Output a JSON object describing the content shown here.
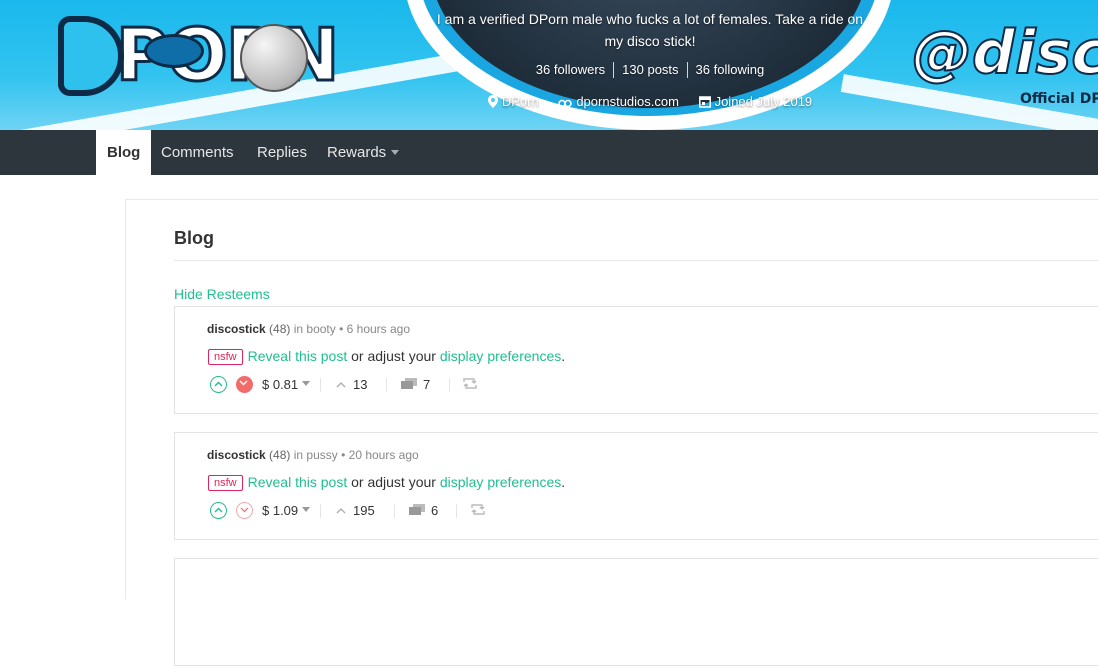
{
  "banner": {
    "logo_text": "DPORN",
    "about": "I am a verified DPorn male who fucks a lot of females. Take a ride on my disco stick!",
    "followers": "36 followers",
    "posts": "130 posts",
    "following": "36 following",
    "location": "DPorn",
    "website": "dpornstudios.com",
    "joined": "Joined July 2019",
    "handle": "@disco",
    "handle_sub": "Official DP"
  },
  "nav": {
    "tabs": [
      {
        "label": "Blog"
      },
      {
        "label": "Comments"
      },
      {
        "label": "Replies"
      },
      {
        "label": "Rewards"
      }
    ]
  },
  "main": {
    "title": "Blog",
    "hide_resteems": "Hide Resteems"
  },
  "posts": [
    {
      "author": "discostick",
      "rep": "(48)",
      "in_text": "in booty",
      "time": "• 6 hours ago",
      "nsfw": "nsfw",
      "reveal": "Reveal this post",
      "middle": " or adjust your ",
      "prefs": "display preferences",
      "end": ".",
      "payout": "$ 0.81",
      "votes": "13",
      "comments": "7",
      "downvoted": true
    },
    {
      "author": "discostick",
      "rep": "(48)",
      "in_text": "in pussy",
      "time": "• 20 hours ago",
      "nsfw": "nsfw",
      "reveal": "Reveal this post",
      "middle": " or adjust your ",
      "prefs": "display preferences",
      "end": ".",
      "payout": "$ 1.09",
      "votes": "195",
      "comments": "6",
      "downvoted": false
    }
  ],
  "colors": {
    "accent": "#1fbf8f",
    "nav_bg": "#2d363d",
    "nsfw": "#e0245e",
    "downvote": "#f26b6b"
  }
}
